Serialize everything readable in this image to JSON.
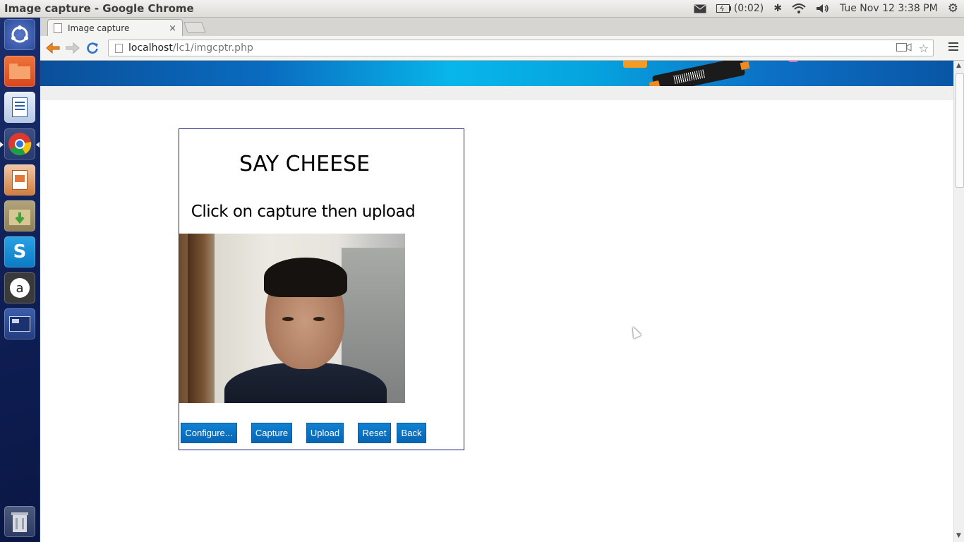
{
  "panel": {
    "window_title": "Image capture - Google Chrome",
    "battery": "(0:02)",
    "datetime": "Tue Nov 12  3:38 PM"
  },
  "launcher": {
    "items": [
      "dash-home",
      "files",
      "libreoffice-writer",
      "chrome",
      "libreoffice-impress",
      "archive-manager",
      "skype",
      "amazon",
      "workspace-switcher",
      "trash"
    ]
  },
  "browser": {
    "tab_title": "Image capture",
    "tab_close": "×",
    "url_host": "localhost",
    "url_path": "/lc1/imgcptr.php"
  },
  "page": {
    "heading": "SAY CHEESE",
    "subheading": "Click on capture then upload",
    "buttons": {
      "configure": "Configure...",
      "capture": "Capture",
      "upload": "Upload",
      "reset": "Reset",
      "back": "Back"
    }
  },
  "colors": {
    "button_blue": "#0a6cc0",
    "card_border": "#1a1a8c",
    "launcher_bg": "#0f1f55"
  }
}
